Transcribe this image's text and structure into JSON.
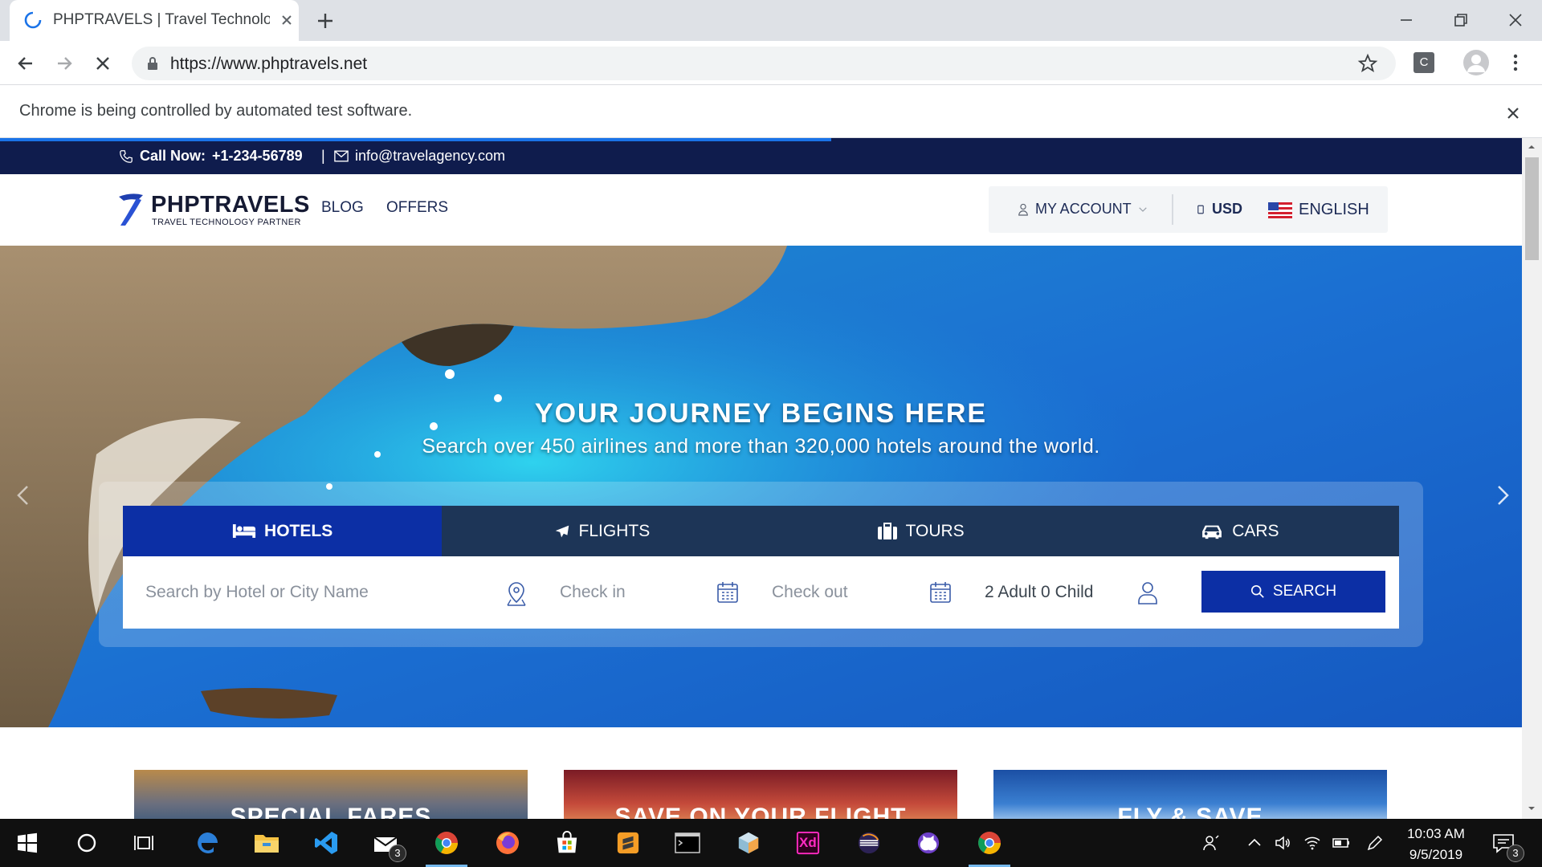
{
  "browser": {
    "tab_title": "PHPTRAVELS | Travel Technology",
    "url": "https://www.phptravels.net",
    "extension_label": "C",
    "infobar_message": "Chrome is being controlled by automated test software."
  },
  "topbar": {
    "call_label": "Call Now:",
    "phone": "+1-234-56789",
    "separator": "|",
    "email": "info@travelagency.com"
  },
  "header": {
    "logo_title": "PHPTRAVELS",
    "logo_subtitle": "TRAVEL TECHNOLOGY PARTNER",
    "nav": [
      "BLOG",
      "OFFERS"
    ],
    "account_label": "MY ACCOUNT",
    "currency": "USD",
    "language": "ENGLISH"
  },
  "hero": {
    "title": "YOUR JOURNEY BEGINS HERE",
    "subtitle": "Search over 450 airlines and more than 320,000 hotels around the world."
  },
  "search": {
    "tabs": [
      "HOTELS",
      "FLIGHTS",
      "TOURS",
      "CARS"
    ],
    "active_tab": "HOTELS",
    "hotel_placeholder": "Search by Hotel or City Name",
    "checkin_placeholder": "Check in",
    "checkout_placeholder": "Check out",
    "guests": "2 Adult 0 Child",
    "button_label": "SEARCH"
  },
  "promos": [
    "SPECIAL FARES",
    "SAVE ON YOUR FLIGHT",
    "FLY & SAVE"
  ],
  "taskbar": {
    "time": "10:03 AM",
    "date": "9/5/2019",
    "mail_badge": "3",
    "notification_badge": "3",
    "xd_label": "Xd"
  },
  "colors": {
    "topbar_bg": "#0f1c4d",
    "accent_blue": "#0c2fa5",
    "tab_dark": "#1d3557"
  }
}
